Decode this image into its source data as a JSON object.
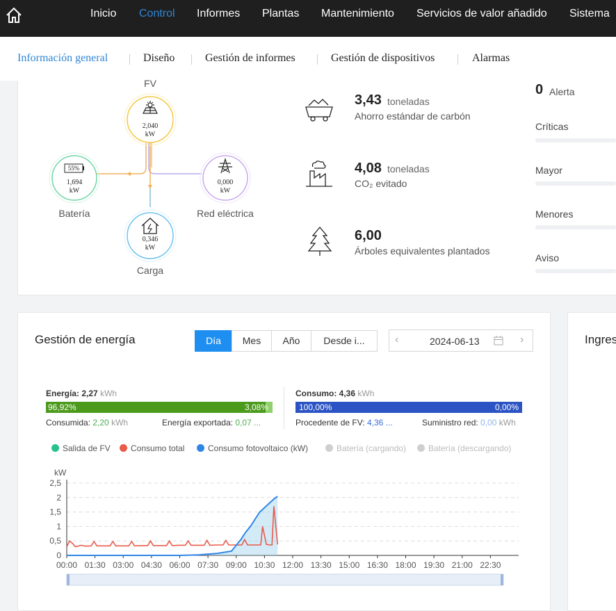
{
  "nav": {
    "items": [
      "Inicio",
      "Control",
      "Informes",
      "Plantas",
      "Mantenimiento",
      "Servicios de valor añadido",
      "Sistema"
    ],
    "active": "Control"
  },
  "subnav": {
    "items": [
      "Información general",
      "Diseño",
      "Gestión de informes",
      "Gestión de dispositivos",
      "Alarmas"
    ],
    "active": "Información general"
  },
  "flow": {
    "pv": {
      "label": "FV",
      "value": "2,040",
      "unit": "kW"
    },
    "battery": {
      "label": "Batería",
      "value": "1,694",
      "unit": "kW",
      "soc": "55%"
    },
    "grid": {
      "label": "Red eléctrica",
      "value": "0,000",
      "unit": "kW"
    },
    "load": {
      "label": "Carga",
      "value": "0,346",
      "unit": "kW"
    }
  },
  "env": {
    "carbon": {
      "value": "3,43",
      "unit": "toneladas",
      "desc": "Ahorro estándar de carbón"
    },
    "co2": {
      "value": "4,08",
      "unit": "toneladas",
      "desc": "CO₂ evitado"
    },
    "trees": {
      "value": "6,00",
      "desc": "Árboles equivalentes plantados"
    }
  },
  "alerts": {
    "count": "0",
    "label": "Alerta",
    "categories": [
      "Críticas",
      "Mayor",
      "Menores",
      "Aviso"
    ]
  },
  "energy": {
    "title": "Gestión de energía",
    "periods": [
      "Día",
      "Mes",
      "Año",
      "Desde i..."
    ],
    "active_period": "Día",
    "date": "2024-06-13",
    "production": {
      "label": "Energía:",
      "value": "2,27",
      "unit": "kWh",
      "consumed_pct": "96,92%",
      "exported_pct": "3,08%",
      "consumed_fraction": 0.9692,
      "consumed_label": "Consumida:",
      "consumed_value": "2,20",
      "consumed_unit": "kWh",
      "exported_label": "Energía exportada:",
      "exported_value": "0,07 ..."
    },
    "consumption": {
      "label": "Consumo:",
      "value": "4,36",
      "unit": "kWh",
      "pv_pct": "100,00%",
      "grid_pct": "0,00%",
      "pv_fraction": 1.0,
      "pv_label": "Procedente de FV:",
      "pv_value": "4,36 ...",
      "grid_label": "Suministro red:",
      "grid_value": "0,00",
      "grid_unit": "kWh"
    },
    "colors": {
      "green": "#4c9a1c",
      "green_light": "#8fd06a",
      "blue": "#2b53c4",
      "accent": "#1e8ff0"
    }
  },
  "side_card_title": "Ingres",
  "chart_data": {
    "type": "line",
    "ylabel": "kW",
    "ylim": [
      0,
      2.5
    ],
    "yticks": [
      "0",
      "0,5",
      "1",
      "1,5",
      "2",
      "2,5"
    ],
    "xticks": [
      "00:00",
      "01:30",
      "03:00",
      "04:30",
      "06:00",
      "07:30",
      "09:00",
      "10:30",
      "12:00",
      "13:30",
      "15:00",
      "16:30",
      "18:00",
      "19:30",
      "21:00",
      "22:30"
    ],
    "grid": true,
    "legend_position": "top",
    "series": [
      {
        "name": "Salida de FV",
        "color": "#27c28a",
        "enabled": true,
        "hours": [],
        "values": []
      },
      {
        "name": "Consumo total",
        "color": "#e95b4b",
        "enabled": true,
        "hours": [
          0.0,
          0.15,
          0.3,
          0.45,
          0.6,
          0.75,
          1.0,
          1.3,
          1.45,
          1.6,
          2.0,
          2.3,
          2.45,
          2.6,
          3.0,
          3.3,
          3.45,
          3.6,
          4.0,
          4.3,
          4.45,
          4.6,
          5.0,
          5.3,
          5.45,
          5.6,
          6.0,
          6.3,
          6.45,
          6.6,
          7.0,
          7.3,
          7.45,
          7.6,
          8.0,
          8.3,
          8.45,
          8.6,
          9.0,
          9.3,
          9.45,
          9.6,
          10.0,
          10.2,
          10.3,
          10.4,
          10.6,
          10.8,
          10.9,
          11.0,
          11.2
        ],
        "values": [
          0.3,
          0.5,
          0.42,
          0.3,
          0.32,
          0.35,
          0.32,
          0.33,
          0.48,
          0.33,
          0.33,
          0.33,
          0.48,
          0.33,
          0.33,
          0.33,
          0.48,
          0.33,
          0.34,
          0.34,
          0.5,
          0.34,
          0.34,
          0.34,
          0.5,
          0.34,
          0.35,
          0.35,
          0.5,
          0.35,
          0.35,
          0.35,
          0.52,
          0.35,
          0.36,
          0.36,
          0.52,
          0.36,
          0.36,
          0.36,
          0.55,
          0.36,
          0.36,
          0.36,
          0.36,
          1.0,
          0.38,
          0.36,
          0.36,
          1.7,
          0.38
        ]
      },
      {
        "name": "Consumo fotovoltaico (kW)",
        "color": "#2f86e6",
        "enabled": true,
        "hours": [
          0.0,
          6.0,
          7.0,
          8.0,
          8.75,
          9.0,
          9.25,
          9.5,
          9.75,
          10.0,
          10.25,
          10.5,
          10.75,
          11.0,
          11.2
        ],
        "values": [
          0.0,
          0.0,
          0.02,
          0.07,
          0.15,
          0.35,
          0.55,
          0.8,
          1.0,
          1.25,
          1.5,
          1.65,
          1.8,
          1.95,
          2.04
        ]
      },
      {
        "name": "Batería (cargando)",
        "color": "#cfcfcf",
        "enabled": false,
        "hours": [],
        "values": []
      },
      {
        "name": "Batería (descargando)",
        "color": "#cfcfcf",
        "enabled": false,
        "hours": [],
        "values": []
      }
    ]
  }
}
